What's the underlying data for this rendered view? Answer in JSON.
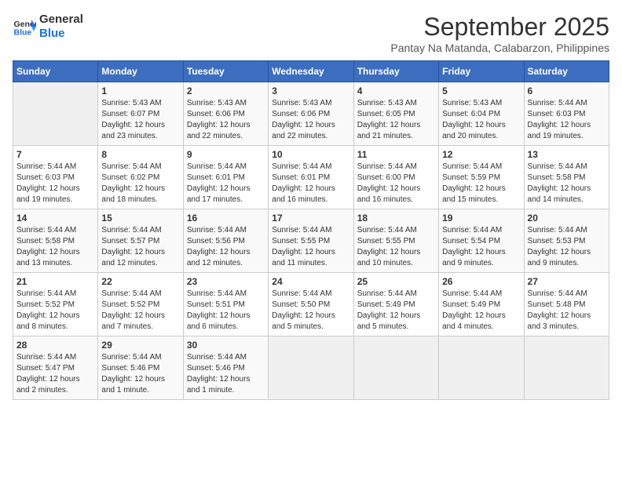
{
  "header": {
    "logo_line1": "General",
    "logo_line2": "Blue",
    "month": "September 2025",
    "location": "Pantay Na Matanda, Calabarzon, Philippines"
  },
  "weekdays": [
    "Sunday",
    "Monday",
    "Tuesday",
    "Wednesday",
    "Thursday",
    "Friday",
    "Saturday"
  ],
  "weeks": [
    [
      {
        "day": "",
        "info": ""
      },
      {
        "day": "1",
        "info": "Sunrise: 5:43 AM\nSunset: 6:07 PM\nDaylight: 12 hours\nand 23 minutes."
      },
      {
        "day": "2",
        "info": "Sunrise: 5:43 AM\nSunset: 6:06 PM\nDaylight: 12 hours\nand 22 minutes."
      },
      {
        "day": "3",
        "info": "Sunrise: 5:43 AM\nSunset: 6:06 PM\nDaylight: 12 hours\nand 22 minutes."
      },
      {
        "day": "4",
        "info": "Sunrise: 5:43 AM\nSunset: 6:05 PM\nDaylight: 12 hours\nand 21 minutes."
      },
      {
        "day": "5",
        "info": "Sunrise: 5:43 AM\nSunset: 6:04 PM\nDaylight: 12 hours\nand 20 minutes."
      },
      {
        "day": "6",
        "info": "Sunrise: 5:44 AM\nSunset: 6:03 PM\nDaylight: 12 hours\nand 19 minutes."
      }
    ],
    [
      {
        "day": "7",
        "info": "Sunrise: 5:44 AM\nSunset: 6:03 PM\nDaylight: 12 hours\nand 19 minutes."
      },
      {
        "day": "8",
        "info": "Sunrise: 5:44 AM\nSunset: 6:02 PM\nDaylight: 12 hours\nand 18 minutes."
      },
      {
        "day": "9",
        "info": "Sunrise: 5:44 AM\nSunset: 6:01 PM\nDaylight: 12 hours\nand 17 minutes."
      },
      {
        "day": "10",
        "info": "Sunrise: 5:44 AM\nSunset: 6:01 PM\nDaylight: 12 hours\nand 16 minutes."
      },
      {
        "day": "11",
        "info": "Sunrise: 5:44 AM\nSunset: 6:00 PM\nDaylight: 12 hours\nand 16 minutes."
      },
      {
        "day": "12",
        "info": "Sunrise: 5:44 AM\nSunset: 5:59 PM\nDaylight: 12 hours\nand 15 minutes."
      },
      {
        "day": "13",
        "info": "Sunrise: 5:44 AM\nSunset: 5:58 PM\nDaylight: 12 hours\nand 14 minutes."
      }
    ],
    [
      {
        "day": "14",
        "info": "Sunrise: 5:44 AM\nSunset: 5:58 PM\nDaylight: 12 hours\nand 13 minutes."
      },
      {
        "day": "15",
        "info": "Sunrise: 5:44 AM\nSunset: 5:57 PM\nDaylight: 12 hours\nand 12 minutes."
      },
      {
        "day": "16",
        "info": "Sunrise: 5:44 AM\nSunset: 5:56 PM\nDaylight: 12 hours\nand 12 minutes."
      },
      {
        "day": "17",
        "info": "Sunrise: 5:44 AM\nSunset: 5:55 PM\nDaylight: 12 hours\nand 11 minutes."
      },
      {
        "day": "18",
        "info": "Sunrise: 5:44 AM\nSunset: 5:55 PM\nDaylight: 12 hours\nand 10 minutes."
      },
      {
        "day": "19",
        "info": "Sunrise: 5:44 AM\nSunset: 5:54 PM\nDaylight: 12 hours\nand 9 minutes."
      },
      {
        "day": "20",
        "info": "Sunrise: 5:44 AM\nSunset: 5:53 PM\nDaylight: 12 hours\nand 9 minutes."
      }
    ],
    [
      {
        "day": "21",
        "info": "Sunrise: 5:44 AM\nSunset: 5:52 PM\nDaylight: 12 hours\nand 8 minutes."
      },
      {
        "day": "22",
        "info": "Sunrise: 5:44 AM\nSunset: 5:52 PM\nDaylight: 12 hours\nand 7 minutes."
      },
      {
        "day": "23",
        "info": "Sunrise: 5:44 AM\nSunset: 5:51 PM\nDaylight: 12 hours\nand 6 minutes."
      },
      {
        "day": "24",
        "info": "Sunrise: 5:44 AM\nSunset: 5:50 PM\nDaylight: 12 hours\nand 5 minutes."
      },
      {
        "day": "25",
        "info": "Sunrise: 5:44 AM\nSunset: 5:49 PM\nDaylight: 12 hours\nand 5 minutes."
      },
      {
        "day": "26",
        "info": "Sunrise: 5:44 AM\nSunset: 5:49 PM\nDaylight: 12 hours\nand 4 minutes."
      },
      {
        "day": "27",
        "info": "Sunrise: 5:44 AM\nSunset: 5:48 PM\nDaylight: 12 hours\nand 3 minutes."
      }
    ],
    [
      {
        "day": "28",
        "info": "Sunrise: 5:44 AM\nSunset: 5:47 PM\nDaylight: 12 hours\nand 2 minutes."
      },
      {
        "day": "29",
        "info": "Sunrise: 5:44 AM\nSunset: 5:46 PM\nDaylight: 12 hours\nand 1 minute."
      },
      {
        "day": "30",
        "info": "Sunrise: 5:44 AM\nSunset: 5:46 PM\nDaylight: 12 hours\nand 1 minute."
      },
      {
        "day": "",
        "info": ""
      },
      {
        "day": "",
        "info": ""
      },
      {
        "day": "",
        "info": ""
      },
      {
        "day": "",
        "info": ""
      }
    ]
  ]
}
